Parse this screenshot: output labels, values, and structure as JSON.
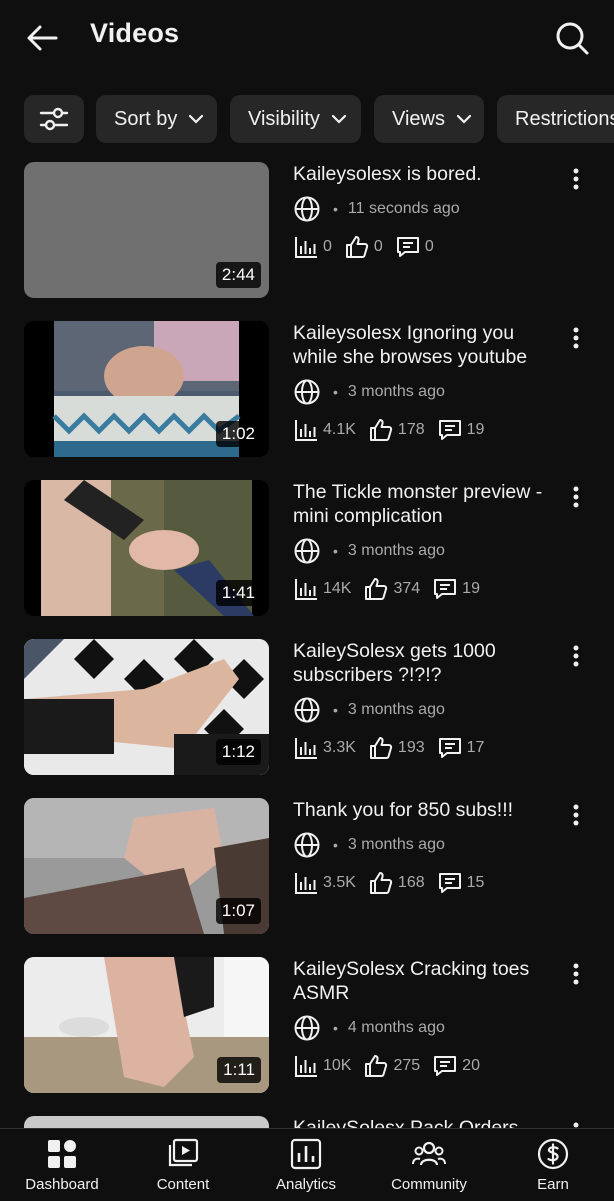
{
  "header": {
    "title": "Videos"
  },
  "filters": [
    {
      "label": "",
      "icon": "tune-icon"
    },
    {
      "label": "Sort by"
    },
    {
      "label": "Visibility"
    },
    {
      "label": "Views"
    },
    {
      "label": "Restrictions"
    }
  ],
  "videos": [
    {
      "title": "Kaileysolesx is bored.",
      "time": "11 seconds ago",
      "views": "0",
      "likes": "0",
      "comments": "0",
      "duration": "2:44"
    },
    {
      "title": "Kaileysolesx Ignoring you while she browses youtube",
      "time": "3 months ago",
      "views": "4.1K",
      "likes": "178",
      "comments": "19",
      "duration": "1:02"
    },
    {
      "title": "The Tickle monster preview - mini complication",
      "time": "3 months ago",
      "views": "14K",
      "likes": "374",
      "comments": "19",
      "duration": "1:41"
    },
    {
      "title": "KaileySolesx gets 1000 subscribers ?!?!?",
      "time": "3 months ago",
      "views": "3.3K",
      "likes": "193",
      "comments": "17",
      "duration": "1:12"
    },
    {
      "title": "Thank you for 850 subs!!!",
      "time": "3 months ago",
      "views": "3.5K",
      "likes": "168",
      "comments": "15",
      "duration": "1:07"
    },
    {
      "title": "KaileySolesx Cracking toes ASMR",
      "time": "4 months ago",
      "views": "10K",
      "likes": "275",
      "comments": "20",
      "duration": "1:11"
    },
    {
      "title": "KaileySolesx Pack Orders",
      "time": "",
      "views": "",
      "likes": "",
      "comments": "",
      "duration": ""
    }
  ],
  "nav": [
    {
      "label": "Dashboard",
      "icon": "dashboard-icon"
    },
    {
      "label": "Content",
      "icon": "content-icon"
    },
    {
      "label": "Analytics",
      "icon": "analytics-icon"
    },
    {
      "label": "Community",
      "icon": "community-icon"
    },
    {
      "label": "Earn",
      "icon": "dollar-icon"
    }
  ],
  "colors": {
    "background": "#0f0f0f",
    "chip": "#272727",
    "text": "#f1f1f1",
    "muted": "#aaaaaa"
  }
}
